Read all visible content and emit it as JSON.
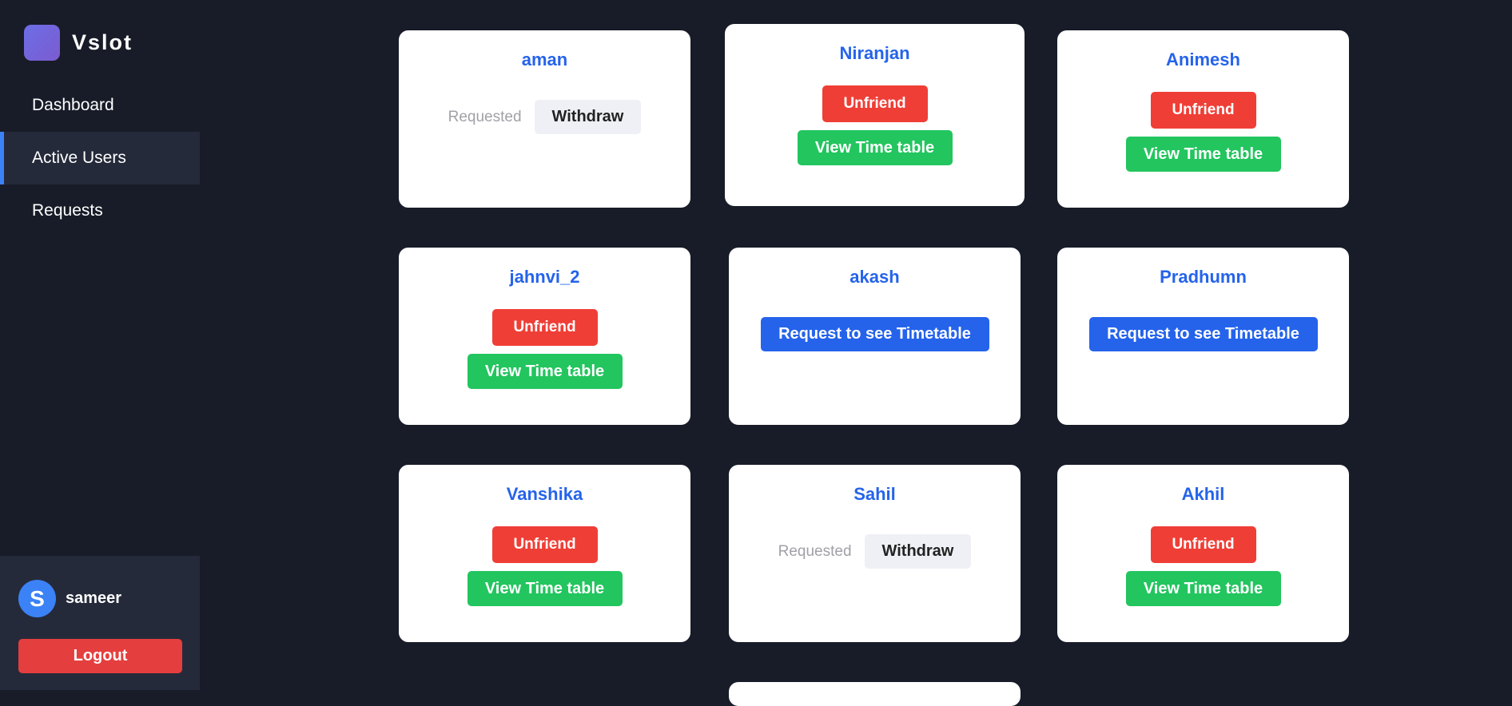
{
  "app": {
    "name": "Vslot"
  },
  "nav": [
    {
      "label": "Dashboard",
      "active": false
    },
    {
      "label": "Active Users",
      "active": true
    },
    {
      "label": "Requests",
      "active": false
    }
  ],
  "user": {
    "initial": "S",
    "name": "sameer",
    "logout_label": "Logout"
  },
  "labels": {
    "unfriend": "Unfriend",
    "view_timetable": "View Time table",
    "request_timetable": "Request to see Timetable",
    "requested": "Requested",
    "withdraw": "Withdraw"
  },
  "users": [
    {
      "name": "aman",
      "status": "requested"
    },
    {
      "name": "Niranjan",
      "status": "friend"
    },
    {
      "name": "Animesh",
      "status": "friend"
    },
    {
      "name": "jahnvi_2",
      "status": "friend"
    },
    {
      "name": "akash",
      "status": "none"
    },
    {
      "name": "Pradhumn",
      "status": "none"
    },
    {
      "name": "Vanshika",
      "status": "friend"
    },
    {
      "name": "Sahil",
      "status": "requested"
    },
    {
      "name": "Akhil",
      "status": "friend"
    }
  ],
  "colors": {
    "background": "#181c28",
    "sidebar_active": "#252a3a",
    "accent": "#3b82f6",
    "name_text": "#2563eb",
    "unfriend": "#ef3e36",
    "view": "#22c55e",
    "request": "#2563eb",
    "logout": "#e53e3e"
  }
}
